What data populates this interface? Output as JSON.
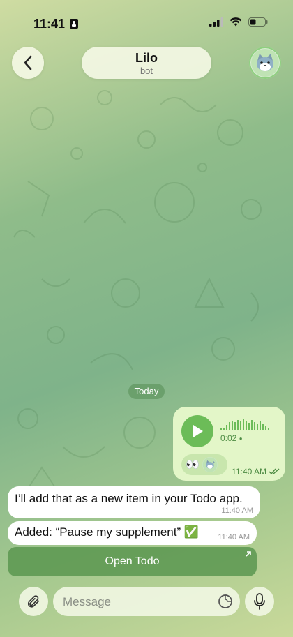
{
  "status_bar": {
    "time": "11:41"
  },
  "header": {
    "title": "Lilo",
    "subtitle": "bot"
  },
  "chat": {
    "date_label": "Today",
    "outgoing_voice": {
      "duration": "0:02",
      "reactions": [
        "👀"
      ],
      "time": "11:40 AM",
      "status": "read"
    },
    "incoming": [
      {
        "text": "I’ll add that as a new item in your Todo app.",
        "time": "11:40 AM"
      },
      {
        "text": "Added: “Pause my supplement” ✅",
        "time": "11:40 AM"
      }
    ],
    "inline_button": {
      "label": "Open Todo"
    }
  },
  "composer": {
    "placeholder": "Message"
  },
  "colors": {
    "accent": "#6cbc58",
    "bubble_out": "#e3f6c8",
    "bubble_in": "#ffffff"
  }
}
